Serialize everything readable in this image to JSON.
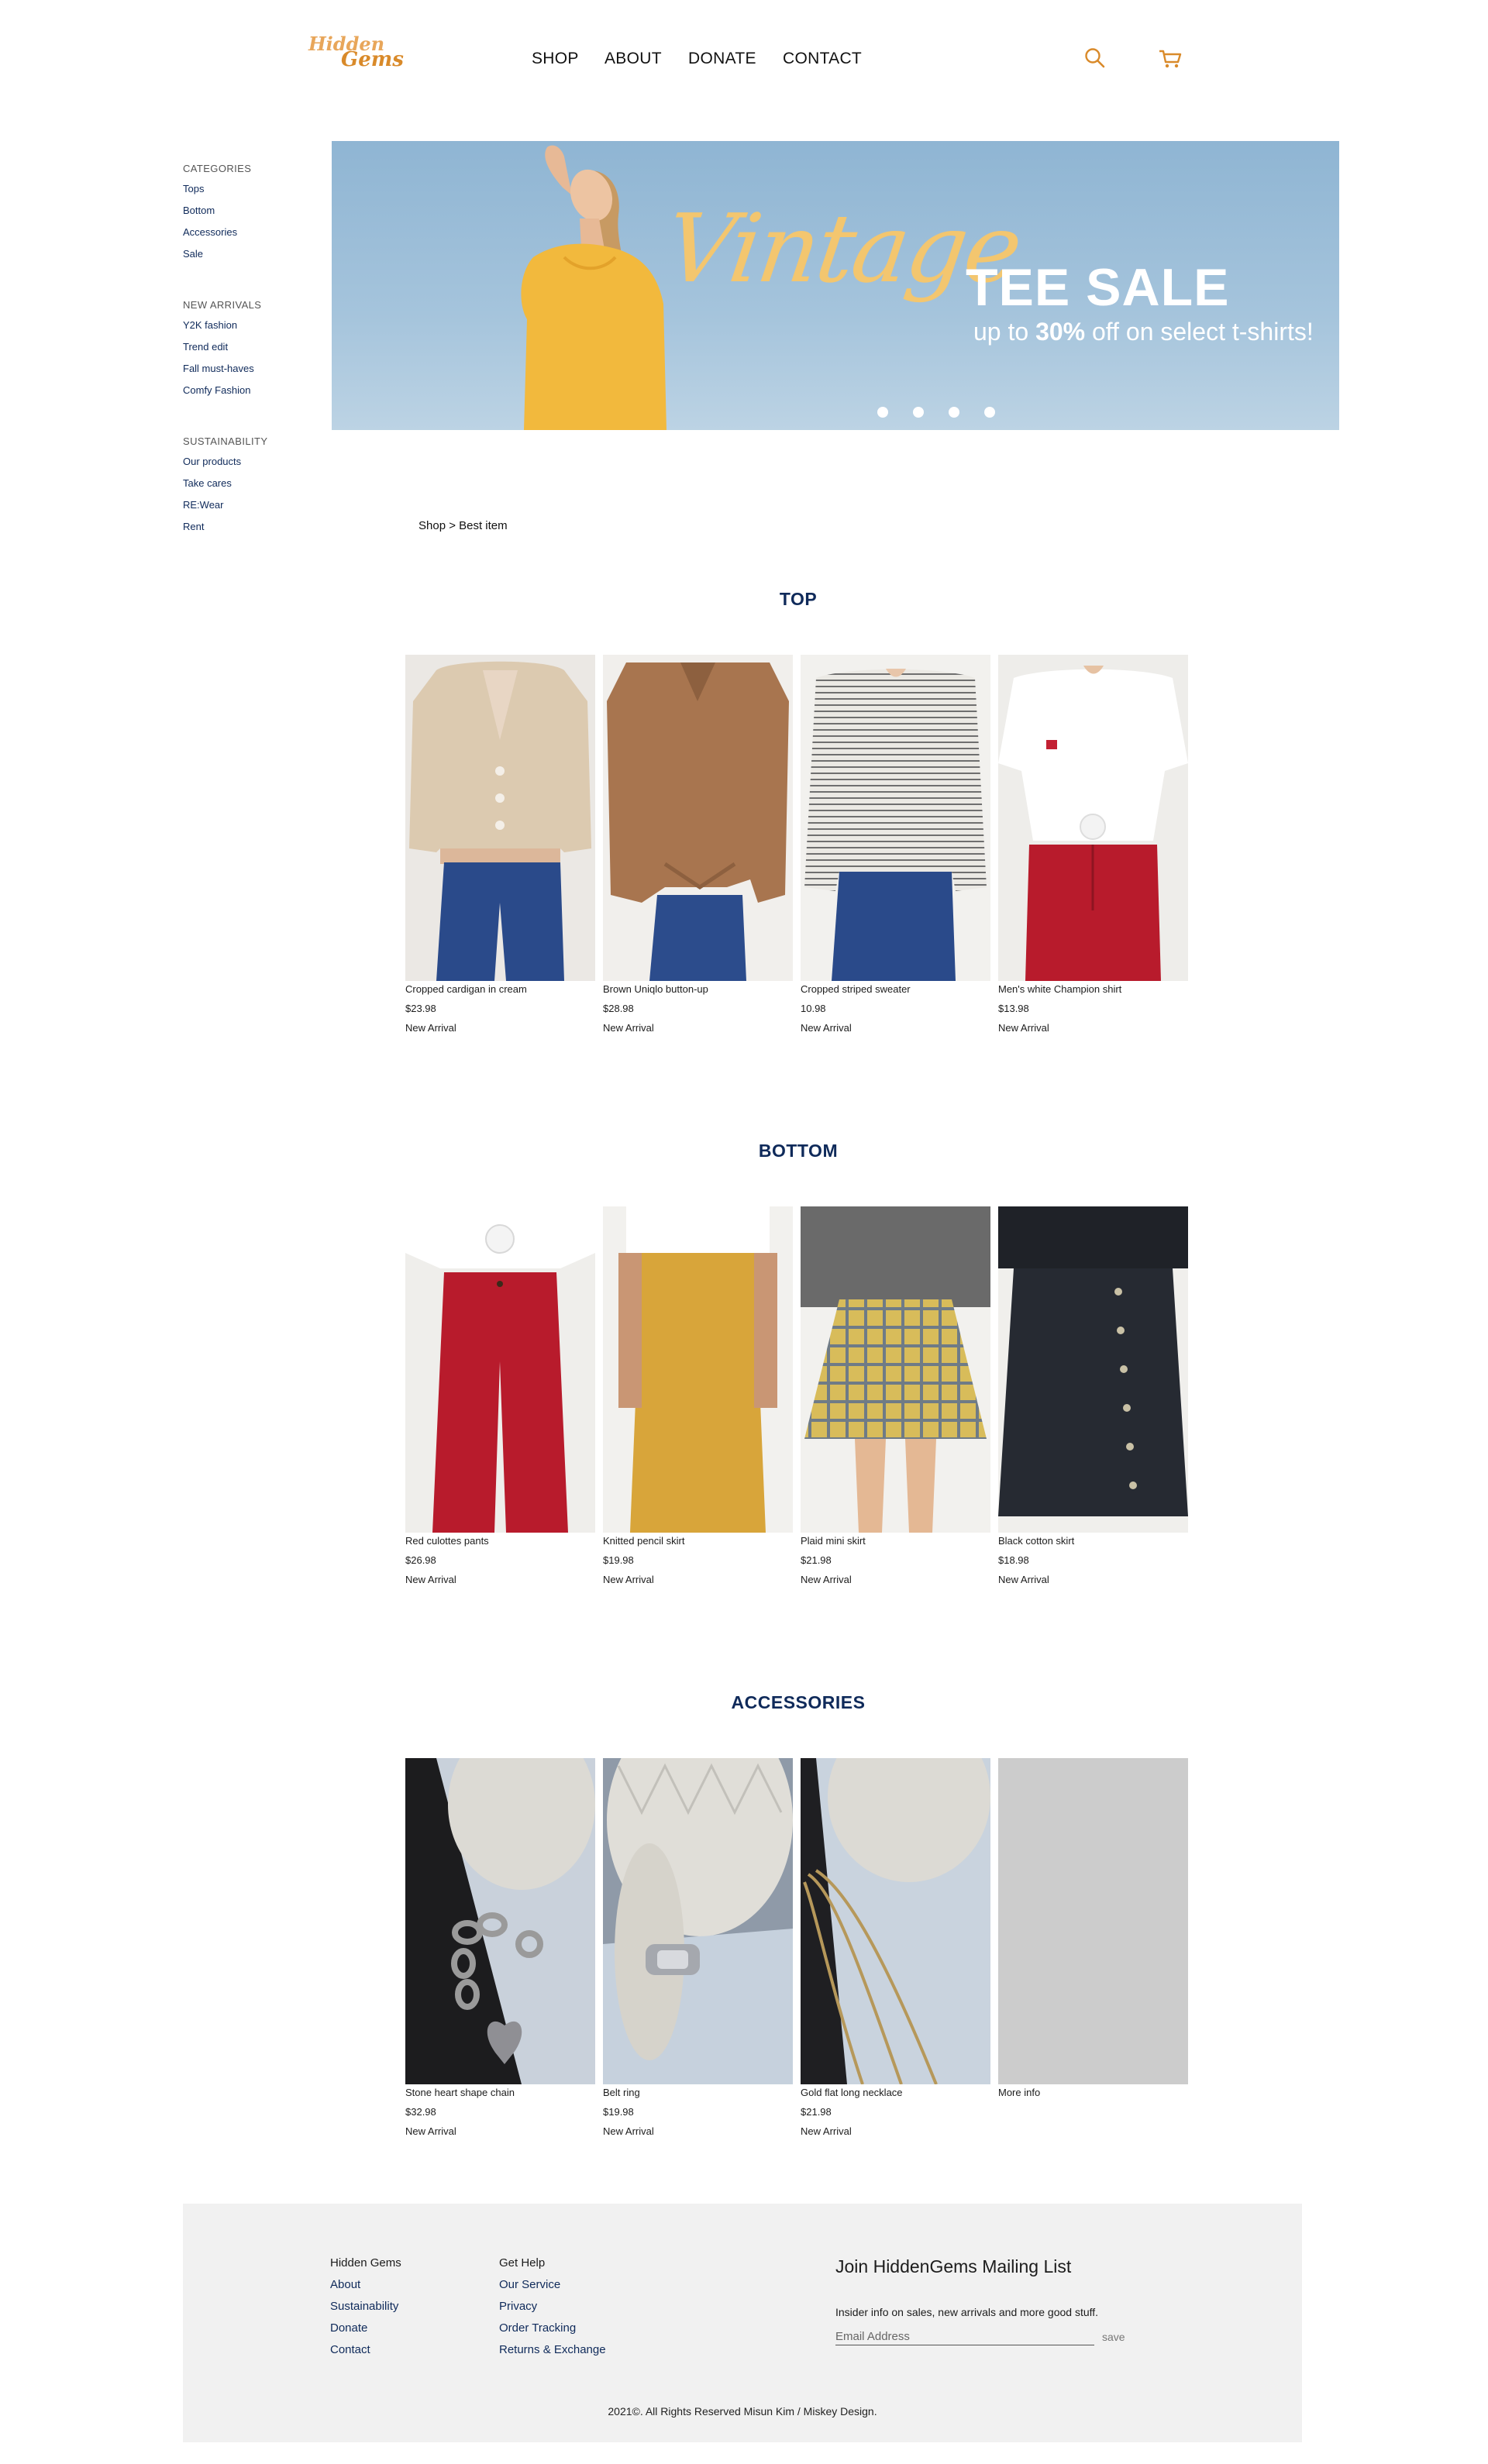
{
  "header": {
    "logo": {
      "line1": "Hidden",
      "line2": "Gems"
    },
    "nav": [
      "SHOP",
      "ABOUT",
      "DONATE",
      "CONTACT"
    ],
    "icons": [
      "search-icon",
      "cart-icon"
    ],
    "accent_color": "#d98a2a"
  },
  "sidebar": {
    "groups": [
      {
        "heading": "CATEGORIES",
        "items": [
          "Tops",
          "Bottom",
          "Accessories",
          "Sale"
        ]
      },
      {
        "heading": "NEW ARRIVALS",
        "items": [
          "Y2K fashion",
          "Trend edit",
          "Fall must-haves",
          "Comfy Fashion"
        ]
      },
      {
        "heading": "SUSTAINABILITY",
        "items": [
          "Our products",
          "Take cares",
          "RE:Wear",
          "Rent"
        ]
      }
    ]
  },
  "banner": {
    "script_word": "Vintage",
    "title": "TEE SALE",
    "subtitle_pre": "up to ",
    "subtitle_bold": "30%",
    "subtitle_post": " off on select t-shirts!",
    "slide_count": 4
  },
  "breadcrumb": "Shop > Best item",
  "sections": [
    {
      "title": "TOP",
      "products": [
        {
          "name": "Cropped cardigan in cream",
          "price": "$23.98",
          "tag": "New Arrival"
        },
        {
          "name": "Brown Uniqlo button-up",
          "price": "$28.98",
          "tag": "New Arrival"
        },
        {
          "name": "Cropped striped sweater",
          "price": "10.98",
          "tag": "New Arrival"
        },
        {
          "name": "Men's white Champion shirt",
          "price": "$13.98",
          "tag": "New Arrival"
        }
      ]
    },
    {
      "title": "BOTTOM",
      "products": [
        {
          "name": "Red culottes pants",
          "price": "$26.98",
          "tag": "New Arrival"
        },
        {
          "name": "Knitted pencil skirt",
          "price": "$19.98",
          "tag": "New Arrival"
        },
        {
          "name": "Plaid mini skirt",
          "price": "$21.98",
          "tag": "New Arrival"
        },
        {
          "name": "Black cotton skirt",
          "price": "$18.98",
          "tag": "New Arrival"
        }
      ]
    },
    {
      "title": "ACCESSORIES",
      "products": [
        {
          "name": "Stone heart shape chain",
          "price": "$32.98",
          "tag": "New Arrival"
        },
        {
          "name": "Belt ring",
          "price": "$19.98",
          "tag": "New Arrival"
        },
        {
          "name": "Gold flat long necklace",
          "price": "$21.98",
          "tag": "New Arrival"
        },
        {
          "name": "More info",
          "price": "",
          "tag": ""
        }
      ]
    }
  ],
  "footer": {
    "col1": {
      "heading": "Hidden Gems",
      "links": [
        "About",
        "Sustainability",
        "Donate",
        "Contact"
      ]
    },
    "col2": {
      "heading": "Get Help",
      "links": [
        "Our Service",
        "Privacy",
        "Order Tracking",
        "Returns & Exchange"
      ]
    },
    "mailing": {
      "title": "Join HiddenGems Mailing List",
      "description": "Insider info on sales, new arrivals and more good stuff.",
      "placeholder": "Email Address",
      "save_label": "save"
    },
    "copyright": "2021©. All Rights Reserved Misun Kim / Miskey Design."
  }
}
